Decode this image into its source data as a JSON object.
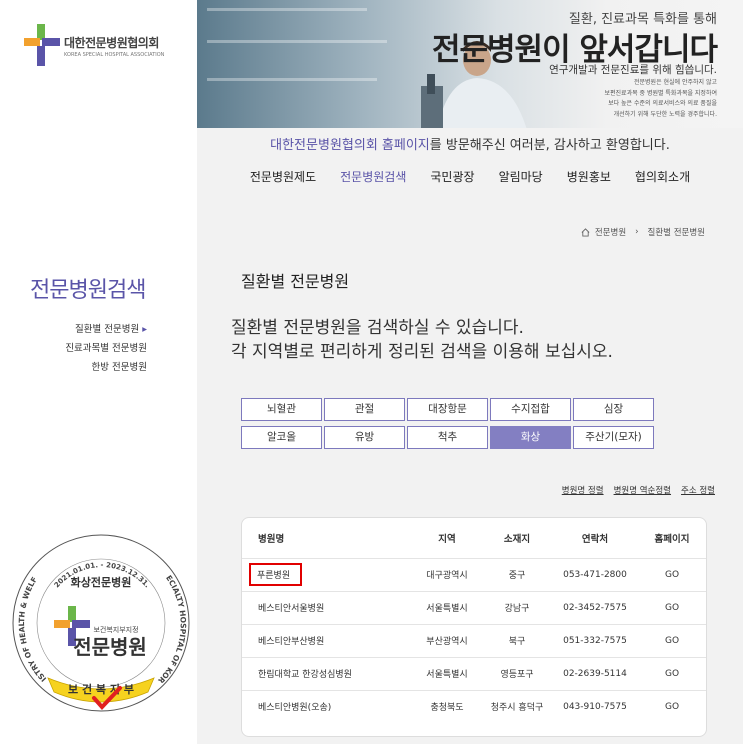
{
  "logo": {
    "name": "대한전문병원협의회",
    "sub": "KOREA SPECIAL HOSPITAL ASSOCIATION"
  },
  "sidebar": {
    "title": "전문병원검색",
    "items": [
      {
        "label": "질환별 전문병원",
        "active": true
      },
      {
        "label": "진료과목별 전문병원",
        "active": false
      },
      {
        "label": "한방 전문병원",
        "active": false
      }
    ]
  },
  "seal": {
    "arc_top": "2021.01.01. - 2023.12.31.",
    "arc_left": "MINISTRY OF HEALTH & WELFARE",
    "arc_right": "SPECIALTY HOSPITAL OF KOREA",
    "specialty": "화상전문병원",
    "designation": "보건복지부지정",
    "main": "전문병원",
    "ribbon": "보 건 복 지 부"
  },
  "banner": {
    "line1": "질환, 진료과목 특화를 통해",
    "line2": "전문병원이 앞서갑니다",
    "line3": "연구개발과 전문진료를 위해 힘씁니다.",
    "small": [
      "전문병원은 현실에 안주하지 않고",
      "보편진료과목 중 병원별 특화과목을 지정하여",
      "보다 높은 수준의 의료서비스와 의료 품질을",
      "개선하기 위해 두단한 노력을 경주합니다."
    ]
  },
  "welcome": {
    "highlight": "대한전문병원협의회 홈페이지",
    "rest": "를 방문해주신 여러분, 감사하고 환영합니다."
  },
  "gnb": [
    "전문병원제도",
    "전문병원검색",
    "국민광장",
    "알림마당",
    "병원홍보",
    "협의회소개"
  ],
  "gnb_active": 1,
  "breadcrumb": {
    "home": "전문병원",
    "current": "질환별 전문병원"
  },
  "page_title": "질환별 전문병원",
  "description": [
    "질환별 전문병원을 검색하실 수 있습니다.",
    "각 지역별로 편리하게 정리된 검색을 이용해 보십시오."
  ],
  "categories": [
    "뇌혈관",
    "관절",
    "대장항문",
    "수지접합",
    "심장",
    "알코올",
    "유방",
    "척추",
    "화상",
    "주산기(모자)"
  ],
  "category_selected": 8,
  "sort_links": [
    "병원명 정렬",
    "병원명 역순정렬",
    "주소 정렬"
  ],
  "table": {
    "headers": [
      "병원명",
      "지역",
      "소재지",
      "연락처",
      "홈페이지"
    ],
    "rows": [
      [
        "푸른병원",
        "대구광역시",
        "중구",
        "053-471-2800",
        "GO"
      ],
      [
        "베스티안서울병원",
        "서울특별시",
        "강남구",
        "02-3452-7575",
        "GO"
      ],
      [
        "베스티안부산병원",
        "부산광역시",
        "북구",
        "051-332-7575",
        "GO"
      ],
      [
        "한림대학교 한강성심병원",
        "서울특별시",
        "영등포구",
        "02-2639-5114",
        "GO"
      ],
      [
        "베스티안병원(오송)",
        "충청북도",
        "청주시 흥덕구",
        "043-910-7575",
        "GO"
      ]
    ]
  },
  "colors": {
    "accent": "#5a54a8",
    "button_selected": "#837fc2",
    "highlight_box": "#e10000"
  }
}
